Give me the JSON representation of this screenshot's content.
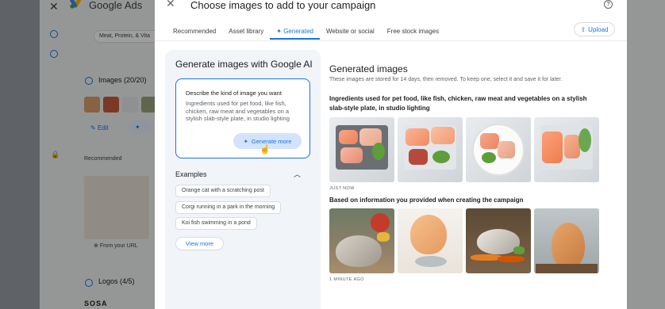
{
  "background": {
    "app_title": "Google Ads",
    "chip_text": "Meat, Protein, & Vita",
    "images_section": "Images (20/20)",
    "edit_label": "Edit",
    "recommended_label": "Recommended",
    "from_url_label": "From your URL",
    "logos_section": "Logos (4/5)",
    "logo_text": "SOSA"
  },
  "modal": {
    "title": "Choose images to add to your campaign",
    "close_icon": "close-icon",
    "help_icon": "help-icon",
    "tabs": [
      {
        "label": "Recommended",
        "active": false
      },
      {
        "label": "Asset library",
        "active": false
      },
      {
        "label": "✦ Generated",
        "active": true
      },
      {
        "label": "Website or social",
        "active": false
      },
      {
        "label": "Free stock images",
        "active": false
      }
    ],
    "upload_label": "Upload",
    "accent_color": "#1a73e8"
  },
  "generator": {
    "title": "Generate images with Google AI",
    "prompt_label": "Describe the kind of image you want",
    "prompt_text": "Ingredients used for pet food, like fish, chicken, raw meat and vegetables on a stylish slab-style plate, in studio lighting",
    "generate_more_label": "Generate more",
    "examples_label": "Examples",
    "examples": [
      "Orange cat with a scratching post",
      "Corgi running in a park in the morning",
      "Koi fish swimming in a pond"
    ],
    "view_more_label": "View more"
  },
  "results": {
    "title": "Generated images",
    "subtitle": "These images are stored for 14 days, then removed. To keep one, select it and save it for later.",
    "groups": [
      {
        "title": "Ingredients used for pet food, like fish, chicken, raw meat and vegetables on a stylish slab-style plate, in studio lighting",
        "timestamp": "JUST NOW"
      },
      {
        "title": "Based on information you provided when creating the campaign",
        "timestamp": "1 MINUTE AGO"
      }
    ]
  }
}
